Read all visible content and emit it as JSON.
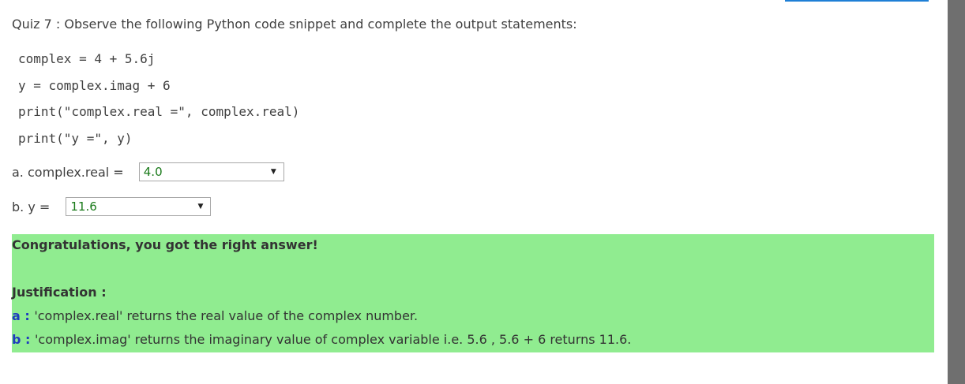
{
  "question": "Quiz 7 : Observe the following Python code snippet and complete the output statements:",
  "code_lines": [
    "complex = 4 + 5.6j",
    "y = complex.imag + 6",
    "print(\"complex.real =\", complex.real)",
    "print(\"y =\", y)"
  ],
  "answers": [
    {
      "label": "a. complex.real = ",
      "value": "4.0",
      "icon": "dropdown-arrow-icon"
    },
    {
      "label": "b. y = ",
      "value": "11.6",
      "icon": "dropdown-arrow-icon"
    }
  ],
  "feedback": {
    "message": "Congratulations, you got the right answer!",
    "justification_title": "Justification :",
    "items": [
      {
        "key": "a",
        "sep": " : ",
        "text": "'complex.real' returns the real value of the complex number."
      },
      {
        "key": "b",
        "sep": " : ",
        "text": "'complex.imag' returns the imaginary value of complex variable i.e. 5.6 , 5.6 + 6 returns 11.6."
      }
    ]
  },
  "colors": {
    "feedback_bg": "#90ec90",
    "answer_text": "#1a7a1a",
    "justification_key": "#1f3bbf"
  }
}
